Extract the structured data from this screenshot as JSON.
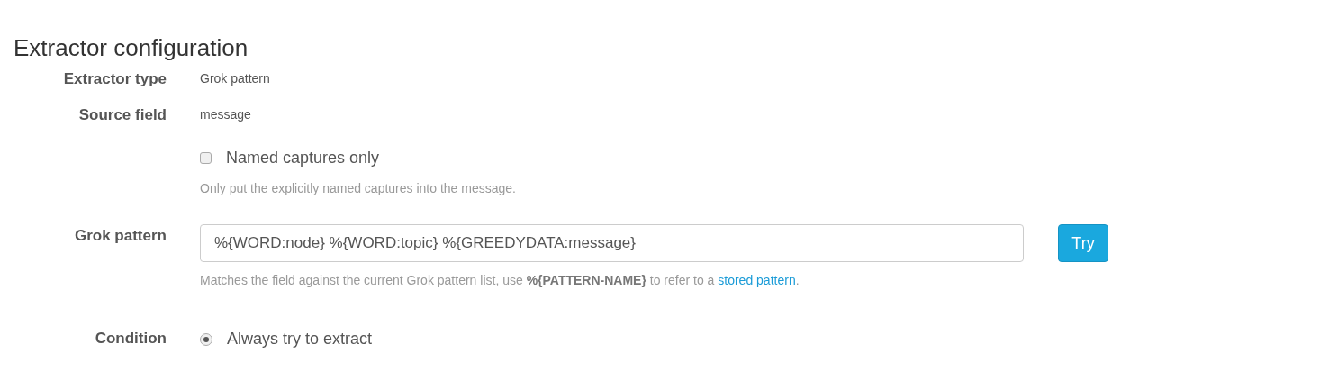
{
  "heading": "Extractor configuration",
  "fields": [
    {
      "kind": "static",
      "label": "Extractor type",
      "value": "Grok pattern"
    },
    {
      "kind": "static",
      "label": "Source field",
      "value": "message"
    },
    {
      "kind": "checkbox",
      "option": "Named captures only",
      "checked": false,
      "help": "Only put the explicitly named captures into the message."
    },
    {
      "kind": "input",
      "label": "Grok pattern",
      "value": "%{WORD:node} %{WORD:topic} %{GREEDYDATA:message}",
      "button": "Try",
      "help": "Matches the field against the current Grok pattern list, use **%{PATTERN-NAME}** to refer to a ",
      "link": "stored pattern",
      "help_end": "."
    },
    {
      "kind": "radio",
      "label": "Condition",
      "options": [
        {
          "label": "Always try to extract",
          "selected": true
        }
      ]
    }
  ]
}
